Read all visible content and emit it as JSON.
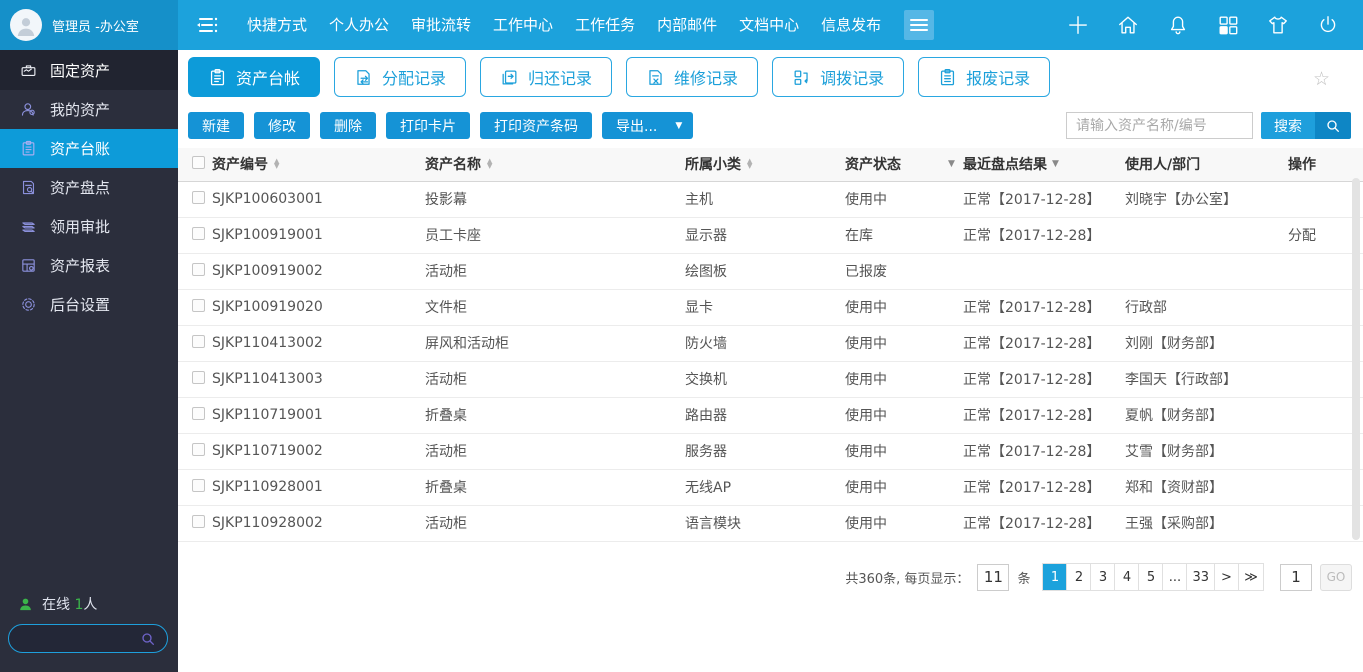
{
  "header": {
    "user_name": "管理员 -办公室",
    "nav": [
      "快捷方式",
      "个人办公",
      "审批流转",
      "工作中心",
      "工作任务",
      "内部邮件",
      "文档中心",
      "信息发布"
    ]
  },
  "sidebar": {
    "module_label": "固定资产",
    "items": [
      {
        "label": "我的资产",
        "active": false
      },
      {
        "label": "资产台账",
        "active": true
      },
      {
        "label": "资产盘点",
        "active": false
      },
      {
        "label": "领用审批",
        "active": false
      },
      {
        "label": "资产报表",
        "active": false
      },
      {
        "label": "后台设置",
        "active": false
      }
    ],
    "online_prefix": "在线",
    "online_count": "1",
    "online_suffix": "人"
  },
  "tabs": [
    {
      "label": "资产台帐",
      "active": true
    },
    {
      "label": "分配记录",
      "active": false
    },
    {
      "label": "归还记录",
      "active": false
    },
    {
      "label": "维修记录",
      "active": false
    },
    {
      "label": "调拨记录",
      "active": false
    },
    {
      "label": "报废记录",
      "active": false
    }
  ],
  "toolbar": {
    "new": "新建",
    "edit": "修改",
    "delete": "删除",
    "print_card": "打印卡片",
    "print_barcode": "打印资产条码",
    "export": "导出...",
    "search_placeholder": "请输入资产名称/编号",
    "search": "搜索"
  },
  "table": {
    "headers": {
      "code": "资产编号",
      "name": "资产名称",
      "category": "所属小类",
      "status": "资产状态",
      "inventory": "最近盘点结果",
      "user": "使用人/部门",
      "action": "操作"
    },
    "rows": [
      {
        "code": "SJKP100603001",
        "name": "投影幕",
        "category": "主机",
        "status": "使用中",
        "inventory": "正常【2017-12-28】",
        "user": "刘晓宇【办公室】",
        "action": ""
      },
      {
        "code": "SJKP100919001",
        "name": "员工卡座",
        "category": "显示器",
        "status": "在库",
        "inventory": "正常【2017-12-28】",
        "user": "",
        "action": "分配"
      },
      {
        "code": "SJKP100919002",
        "name": "活动柜",
        "category": "绘图板",
        "status": "已报废",
        "inventory": "",
        "user": "",
        "action": ""
      },
      {
        "code": "SJKP100919020",
        "name": "文件柜",
        "category": "显卡",
        "status": "使用中",
        "inventory": "正常【2017-12-28】",
        "user": "行政部",
        "action": ""
      },
      {
        "code": "SJKP110413002",
        "name": "屏风和活动柜",
        "category": "防火墙",
        "status": "使用中",
        "inventory": "正常【2017-12-28】",
        "user": "刘刚【财务部】",
        "action": ""
      },
      {
        "code": "SJKP110413003",
        "name": "活动柜",
        "category": "交换机",
        "status": "使用中",
        "inventory": "正常【2017-12-28】",
        "user": "李国天【行政部】",
        "action": ""
      },
      {
        "code": "SJKP110719001",
        "name": "折叠桌",
        "category": "路由器",
        "status": "使用中",
        "inventory": "正常【2017-12-28】",
        "user": "夏帆【财务部】",
        "action": ""
      },
      {
        "code": "SJKP110719002",
        "name": "活动柜",
        "category": "服务器",
        "status": "使用中",
        "inventory": "正常【2017-12-28】",
        "user": "艾雪【财务部】",
        "action": ""
      },
      {
        "code": "SJKP110928001",
        "name": "折叠桌",
        "category": "无线AP",
        "status": "使用中",
        "inventory": "正常【2017-12-28】",
        "user": "郑和【资财部】",
        "action": ""
      },
      {
        "code": "SJKP110928002",
        "name": "活动柜",
        "category": "语言模块",
        "status": "使用中",
        "inventory": "正常【2017-12-28】",
        "user": "王强【采购部】",
        "action": ""
      }
    ]
  },
  "pagination": {
    "total_text": "共360条, 每页显示：",
    "page_size": "11",
    "unit": "条",
    "pages": [
      "1",
      "2",
      "3",
      "4",
      "5",
      "...",
      "33",
      ">",
      "≫"
    ],
    "goto_value": "1",
    "go_label": "GO"
  },
  "icons": {
    "star": "☆",
    "caret_down": "▼",
    "sort_asc": "▲",
    "sort_desc": "▼"
  },
  "colors": {
    "accent": "#1CA2DC",
    "accent_dark": "#1590C9",
    "active_blue": "#0D9BD9",
    "button_blue": "#1593D6",
    "sidebar_bg": "#2B2E3C",
    "online_green": "#3BB54A"
  }
}
